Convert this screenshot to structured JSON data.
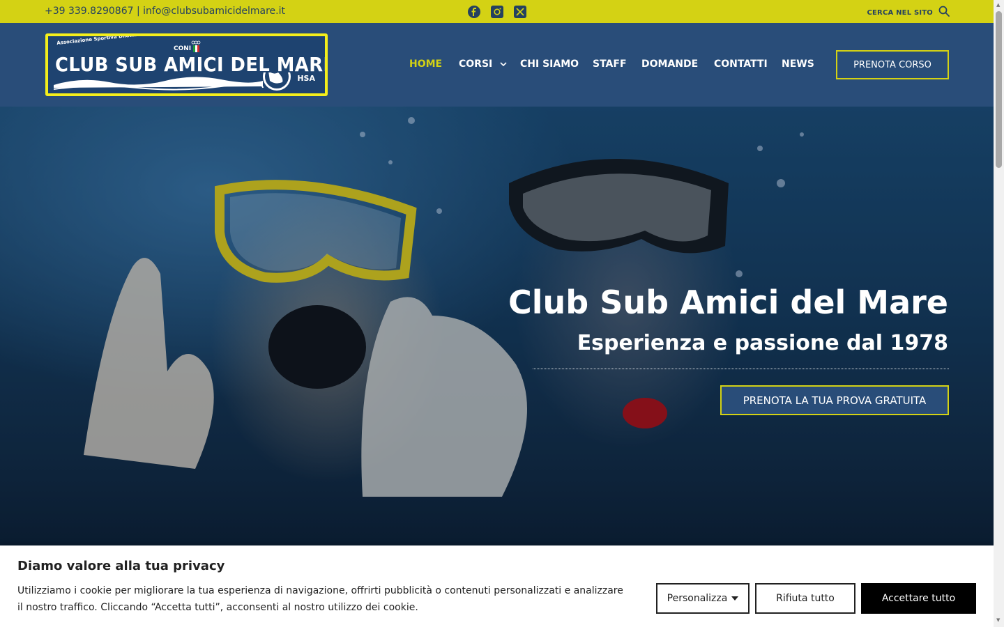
{
  "topbar": {
    "contact": "+39 339.8290867 | info@clubsubamicidelmare.it",
    "social_icons": [
      "facebook-icon",
      "instagram-icon",
      "x-twitter-icon"
    ],
    "search_label": "CERCA NEL SITO"
  },
  "logo": {
    "association": "Associazione Sportiva Dilettantistica",
    "name": "CLUB SUB AMICI DEL MARE",
    "coni": "CONI",
    "hsa": "HSA"
  },
  "nav": {
    "items": [
      {
        "label": "HOME"
      },
      {
        "label": "CORSI"
      },
      {
        "label": "CHI SIAMO"
      },
      {
        "label": "STAFF"
      },
      {
        "label": "DOMANDE"
      },
      {
        "label": "CONTATTI"
      },
      {
        "label": "NEWS"
      }
    ],
    "cta": "PRENOTA CORSO"
  },
  "hero": {
    "title": "Club Sub Amici del Mare",
    "subtitle": "Esperienza e passione dal 1978",
    "button": "PRENOTA LA TUA PROVA GRATUITA"
  },
  "cookie": {
    "title": "Diamo valore alla tua privacy",
    "text": "Utilizziamo i cookie per migliorare la tua esperienza di navigazione, offrirti pubblicità o contenuti personalizzati e analizzare il nostro traffico. Cliccando “Accetta tutti”, acconsenti al nostro utilizzo dei cookie.",
    "customize": "Personalizza",
    "reject": "Rifiuta tutto",
    "accept": "Accettare tutto"
  },
  "colors": {
    "accent_yellow": "#d4d214",
    "header_blue": "#294d79",
    "text_dark": "#25415f"
  }
}
